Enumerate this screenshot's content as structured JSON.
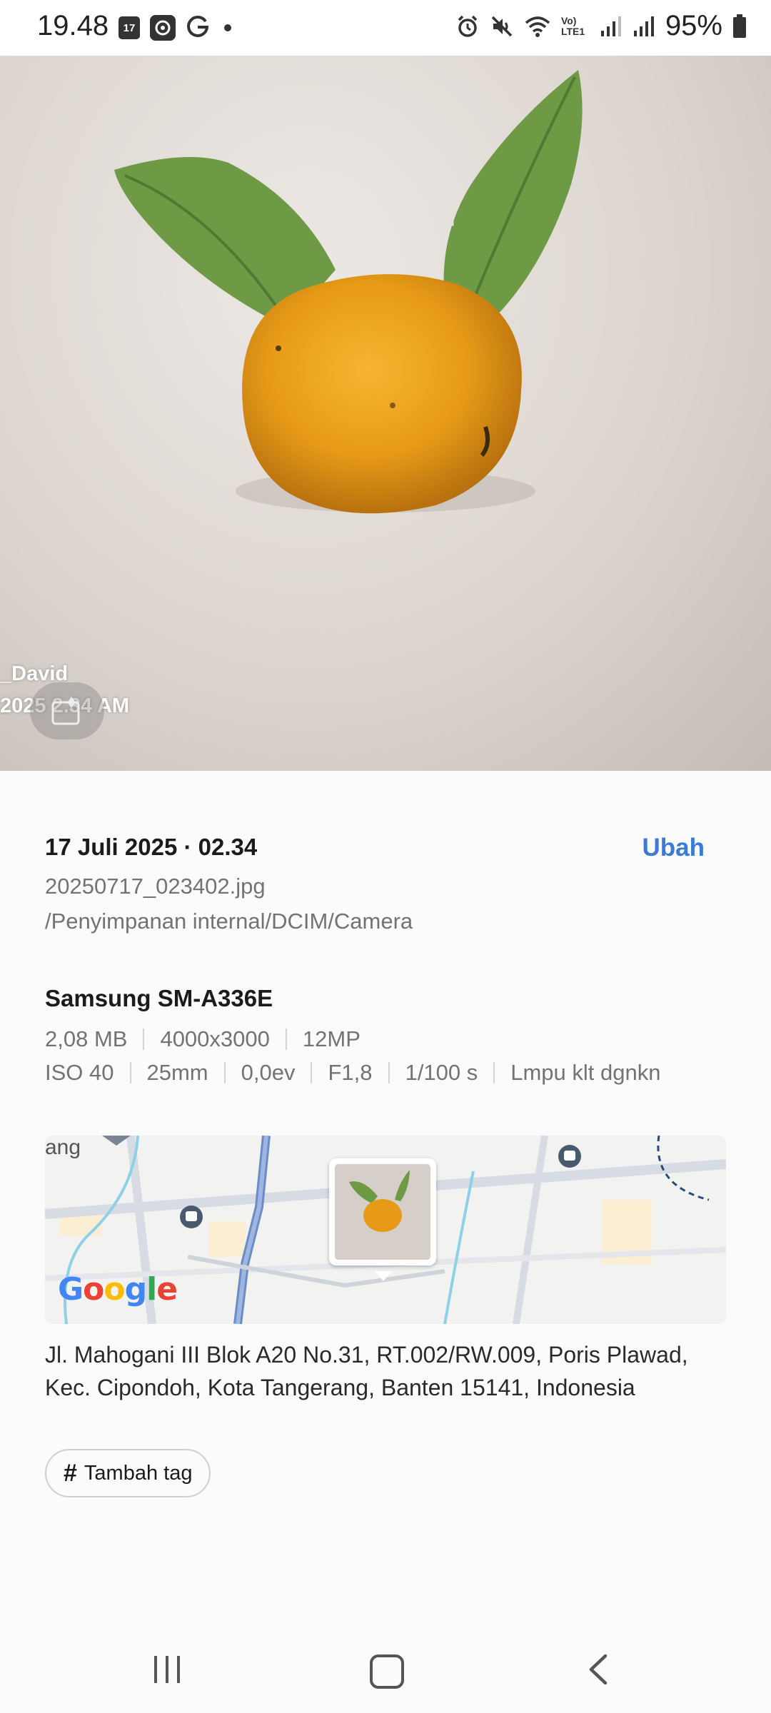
{
  "status_bar": {
    "time": "19.48",
    "calendar_day": "17",
    "battery": "95%",
    "network_label": "Vo) LTE1"
  },
  "photo": {
    "overlay_name": "_David",
    "overlay_date": "2025 2.34 AM"
  },
  "details": {
    "datetime": "17 Juli 2025 · 02.34",
    "edit_label": "Ubah",
    "filename": "20250717_023402.jpg",
    "path": "/Penyimpanan internal/DCIM/Camera",
    "device": "Samsung SM-A336E",
    "specs_row1": [
      "2,08 MB",
      "4000x3000",
      "12MP"
    ],
    "specs_row2": [
      "ISO 40",
      "25mm",
      "0,0ev",
      "F1,8",
      "1/100 s",
      "Lmpu klt dgnkn"
    ],
    "map_partial_label": "ang",
    "map_brand": "Google",
    "address": "Jl. Mahogani III Blok A20 No.31, RT.002/RW.009, Poris Plawad, Kec. Cipondoh, Kota Tangerang, Banten 15141, Indonesia",
    "add_tag_label": "Tambah tag"
  },
  "icons": {
    "status_left": [
      "calendar-icon",
      "app-icon",
      "google-icon",
      "notification-dot-icon"
    ],
    "status_right": [
      "alarm-icon",
      "mute-icon",
      "wifi-icon",
      "signal-icon",
      "signal-icon",
      "battery-icon"
    ],
    "nav": [
      "recent-apps-icon",
      "home-icon",
      "back-icon"
    ]
  },
  "colors": {
    "accent": "#3a7bd5",
    "secondary_text": "#737373"
  }
}
